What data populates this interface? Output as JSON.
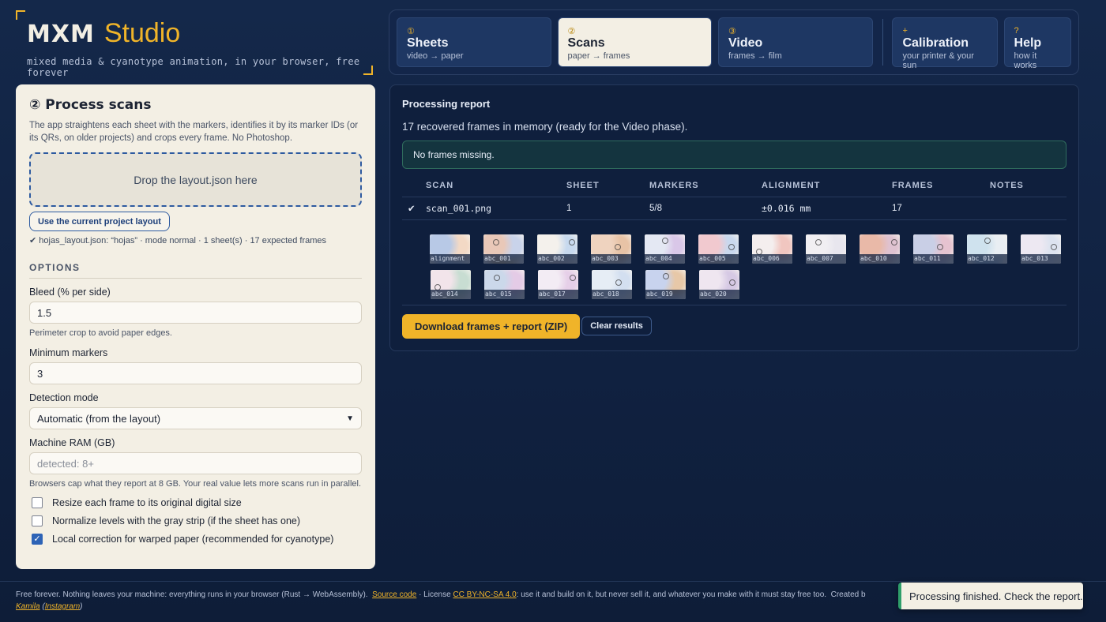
{
  "brand": {
    "name": "MXM",
    "studio": "Studio",
    "tagline": "mixed media & cyanotype animation, in your browser, free forever"
  },
  "tabs": [
    {
      "num": "①",
      "label": "Sheets",
      "sub": "video → paper"
    },
    {
      "num": "②",
      "label": "Scans",
      "sub": "paper → frames"
    },
    {
      "num": "③",
      "label": "Video",
      "sub": "frames → film"
    },
    {
      "num": "+",
      "label": "Calibration",
      "sub": "your printer & your sun"
    },
    {
      "num": "?",
      "label": "Help",
      "sub": "how it works"
    }
  ],
  "process": {
    "title": "② Process scans",
    "description": "The app straightens each sheet with the markers, identifies it by its marker IDs (or its QRs, on older projects) and crops every frame. No Photoshop.",
    "drop_label": "Drop the layout.json here",
    "use_layout_button": "Use the current project layout",
    "loaded_status": "✔ hojas_layout.json: “hojas” · mode normal · 1 sheet(s) · 17 expected frames"
  },
  "options": {
    "title": "OPTIONS",
    "bleed_label": "Bleed (% per side)",
    "bleed_value": "1.5",
    "bleed_help": "Perimeter crop to avoid paper edges.",
    "min_markers_label": "Minimum markers",
    "min_markers_value": "3",
    "detection_label": "Detection mode",
    "detection_value": "Automatic (from the layout)",
    "ram_label": "Machine RAM (GB)",
    "ram_placeholder": "detected: 8+",
    "ram_help": "Browsers cap what they report at 8 GB. Your real value lets more scans run in parallel.",
    "checks": [
      {
        "label": "Resize each frame to its original digital size",
        "checked": false
      },
      {
        "label": "Normalize levels with the gray strip (if the sheet has one)",
        "checked": false
      },
      {
        "label": "Local correction for warped paper (recommended for cyanotype)",
        "checked": true
      }
    ]
  },
  "report": {
    "title": "Processing report",
    "summary": "17 recovered frames in memory (ready for the Video phase).",
    "status": "No frames missing.",
    "columns": [
      "SCAN",
      "SHEET",
      "MARKERS",
      "ALIGNMENT",
      "FRAMES",
      "NOTES"
    ],
    "rows": [
      {
        "status": "✔",
        "scan": "scan_001.png",
        "sheet": "1",
        "markers": "5/8",
        "alignment": "±0.016 mm",
        "frames": "17",
        "notes": ""
      }
    ],
    "thumbnails_row1": [
      "alignment",
      "abc_001",
      "abc_002",
      "abc_003",
      "abc_004",
      "abc_005",
      "abc_006",
      "abc_007",
      "abc_010",
      "abc_011",
      "abc_012",
      "abc_013"
    ],
    "thumbnails_row2": [
      "abc_014",
      "abc_015",
      "abc_017",
      "abc_018",
      "abc_019",
      "abc_020"
    ],
    "download_button": "Download frames + report (ZIP)",
    "clear_button": "Clear results"
  },
  "footer": {
    "text1": "Free forever. Nothing leaves your machine: everything runs in your browser (Rust → WebAssembly).",
    "source_link": "Source code",
    "license_prefix": "· License",
    "license_link": "CC BY-NC-SA 4.0",
    "license_text": ": use it and build on it, but never sell it, and whatever you make with it must stay free too.",
    "created_by": "Created b",
    "author_link": "Kamila",
    "instagram_link": "Instagram"
  },
  "toast": "Processing finished. Check the report.",
  "colors": {
    "accent": "#f0b429",
    "link_blue": "#2d5aa0",
    "background": "#14284a",
    "panel": "#f3efe4"
  }
}
